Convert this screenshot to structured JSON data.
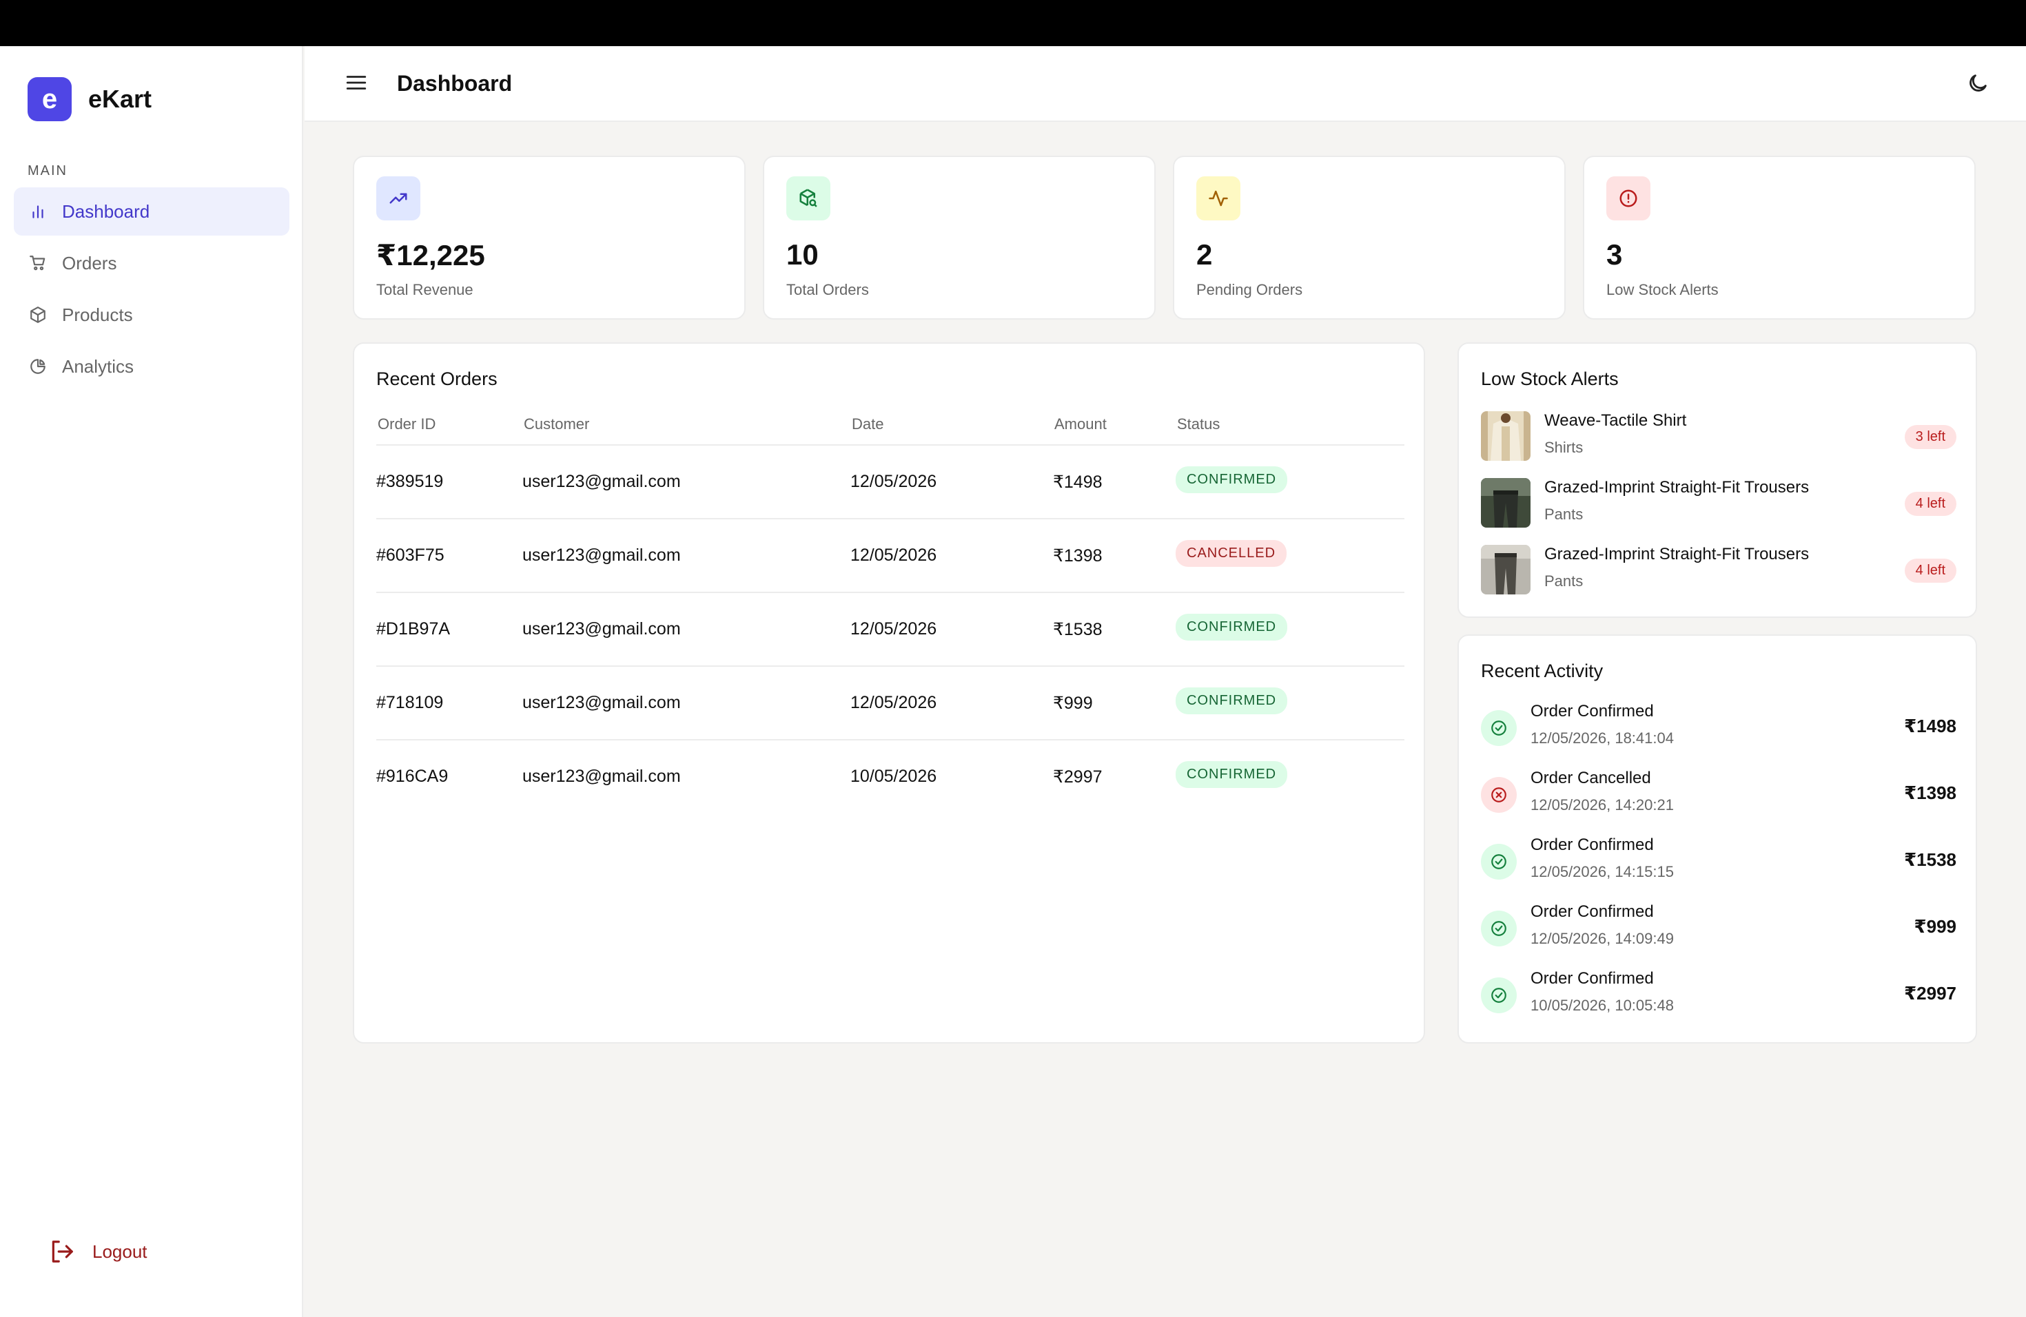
{
  "brand": {
    "logo_letter": "e",
    "name": "eKart",
    "accent": "#4f46e5"
  },
  "sidebar": {
    "section_label": "MAIN",
    "items": [
      {
        "label": "Dashboard",
        "icon": "bar-chart-icon",
        "active": true
      },
      {
        "label": "Orders",
        "icon": "cart-icon",
        "active": false
      },
      {
        "label": "Products",
        "icon": "box-icon",
        "active": false
      },
      {
        "label": "Analytics",
        "icon": "pie-chart-icon",
        "active": false
      }
    ],
    "logout_label": "Logout"
  },
  "header": {
    "title": "Dashboard",
    "menu_icon": "hamburger-menu-icon",
    "theme_icon": "moon-icon"
  },
  "stats": [
    {
      "value": "₹12,225",
      "label": "Total Revenue",
      "icon": "trending-up-icon",
      "bg": "#e0e7ff",
      "fg": "#4338ca"
    },
    {
      "value": "10",
      "label": "Total Orders",
      "icon": "package-search-icon",
      "bg": "#dcfce7",
      "fg": "#15803d"
    },
    {
      "value": "2",
      "label": "Pending Orders",
      "icon": "activity-icon",
      "bg": "#fef9c3",
      "fg": "#a16207"
    },
    {
      "value": "3",
      "label": "Low Stock Alerts",
      "icon": "alert-circle-icon",
      "bg": "#fee2e2",
      "fg": "#b91c1c"
    }
  ],
  "recent_orders": {
    "title": "Recent Orders",
    "columns": [
      "Order ID",
      "Customer",
      "Date",
      "Amount",
      "Status"
    ],
    "rows": [
      {
        "id": "#389519",
        "customer": "user123@gmail.com",
        "date": "12/05/2026",
        "amount": "₹1498",
        "status": "CONFIRMED"
      },
      {
        "id": "#603F75",
        "customer": "user123@gmail.com",
        "date": "12/05/2026",
        "amount": "₹1398",
        "status": "CANCELLED"
      },
      {
        "id": "#D1B97A",
        "customer": "user123@gmail.com",
        "date": "12/05/2026",
        "amount": "₹1538",
        "status": "CONFIRMED"
      },
      {
        "id": "#718109",
        "customer": "user123@gmail.com",
        "date": "12/05/2026",
        "amount": "₹999",
        "status": "CONFIRMED"
      },
      {
        "id": "#916CA9",
        "customer": "user123@gmail.com",
        "date": "10/05/2026",
        "amount": "₹2997",
        "status": "CONFIRMED"
      }
    ]
  },
  "low_stock": {
    "title": "Low Stock Alerts",
    "items": [
      {
        "name": "Weave-Tactile Shirt",
        "category": "Shirts",
        "badge": "3 left"
      },
      {
        "name": "Grazed-Imprint Straight-Fit Trousers",
        "category": "Pants",
        "badge": "4 left"
      },
      {
        "name": "Grazed-Imprint Straight-Fit Trousers",
        "category": "Pants",
        "badge": "4 left"
      }
    ]
  },
  "recent_activity": {
    "title": "Recent Activity",
    "items": [
      {
        "title": "Order Confirmed",
        "time": "12/05/2026, 18:41:04",
        "amount": "₹1498",
        "kind": "ok"
      },
      {
        "title": "Order Cancelled",
        "time": "12/05/2026, 14:20:21",
        "amount": "₹1398",
        "kind": "bad"
      },
      {
        "title": "Order Confirmed",
        "time": "12/05/2026, 14:15:15",
        "amount": "₹1538",
        "kind": "ok"
      },
      {
        "title": "Order Confirmed",
        "time": "12/05/2026, 14:09:49",
        "amount": "₹999",
        "kind": "ok"
      },
      {
        "title": "Order Confirmed",
        "time": "10/05/2026, 10:05:48",
        "amount": "₹2997",
        "kind": "ok"
      }
    ]
  }
}
